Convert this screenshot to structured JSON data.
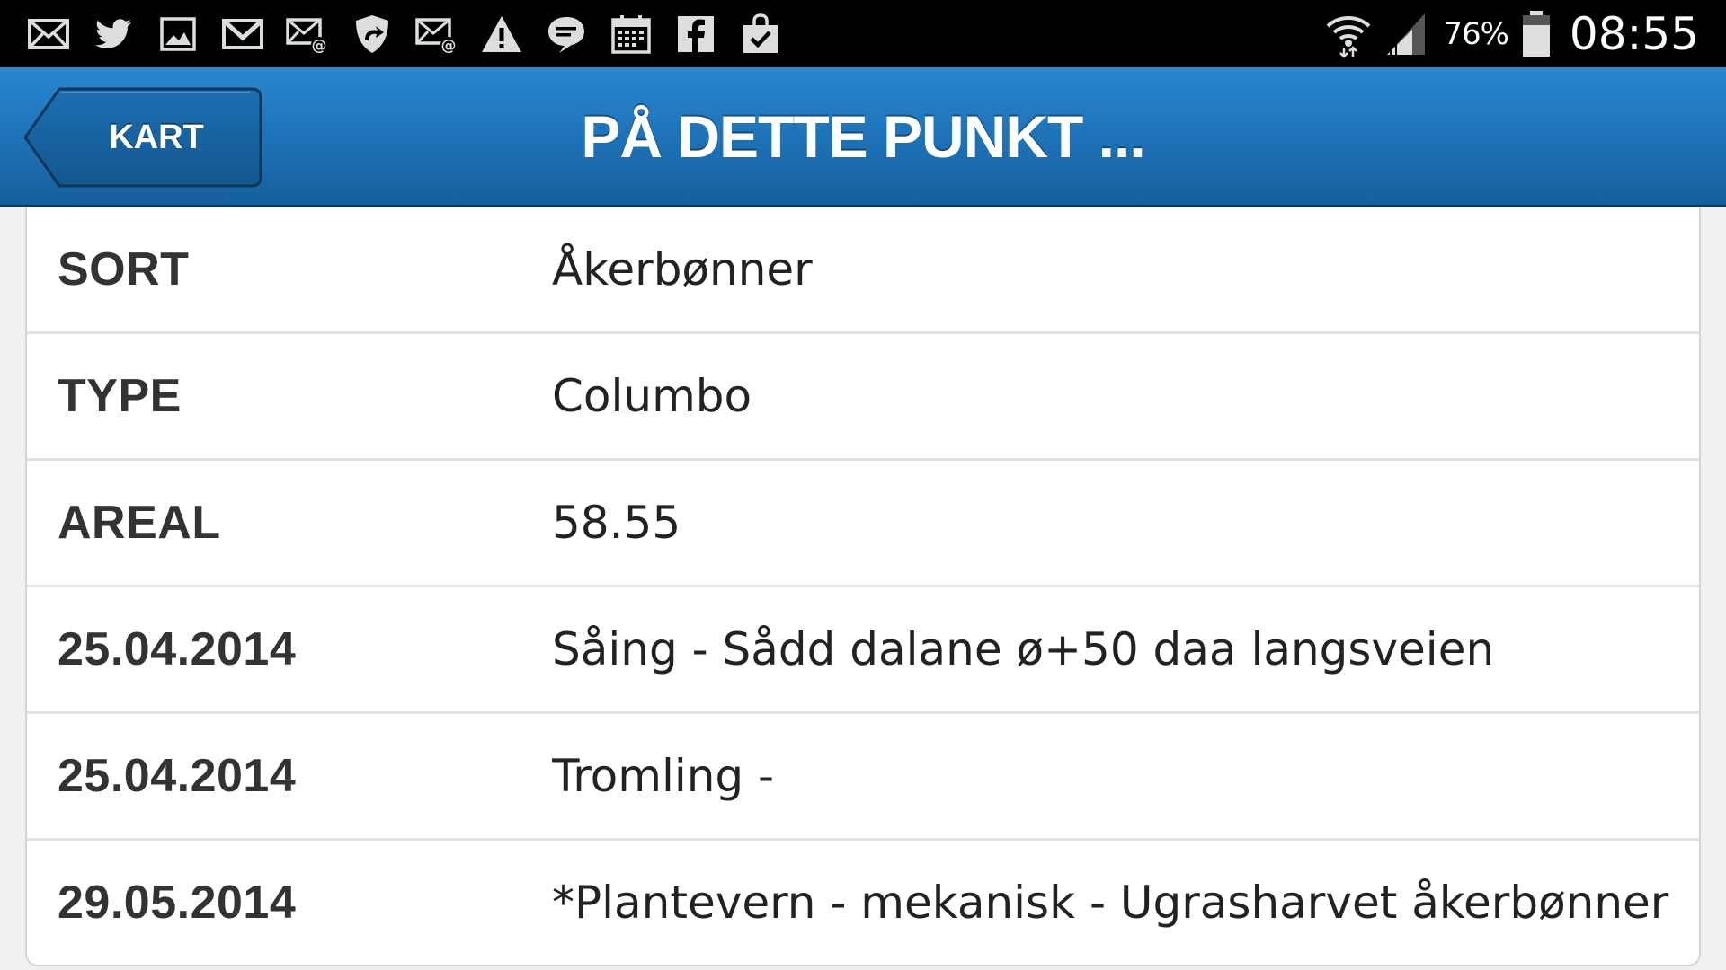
{
  "status_bar": {
    "notification_icons": [
      "email-icon",
      "twitter-icon",
      "gallery-icon",
      "gmail-icon",
      "email-at-icon",
      "shield-sync-icon",
      "email-at-icon",
      "warning-icon",
      "message-icon",
      "calendar-icon",
      "facebook-icon",
      "shopping-bag-check-icon"
    ],
    "battery_percent": "76%",
    "time": "08:55"
  },
  "header": {
    "back_label": "KART",
    "title": "PÅ DETTE PUNKT ..."
  },
  "rows": [
    {
      "key": "SORT",
      "value": "Åkerbønner"
    },
    {
      "key": "TYPE",
      "value": "Columbo"
    },
    {
      "key": "AREAL",
      "value": "58.55"
    },
    {
      "key": "25.04.2014",
      "value": "Såing - Sådd dalane ø+50 daa langsveien"
    },
    {
      "key": "25.04.2014",
      "value": "Tromling -"
    },
    {
      "key": "29.05.2014",
      "value": "*Plantevern - mekanisk - Ugrasharvet åkerbønner"
    }
  ],
  "colors": {
    "header_blue": "#1e73b8",
    "status_bar": "#000000"
  }
}
